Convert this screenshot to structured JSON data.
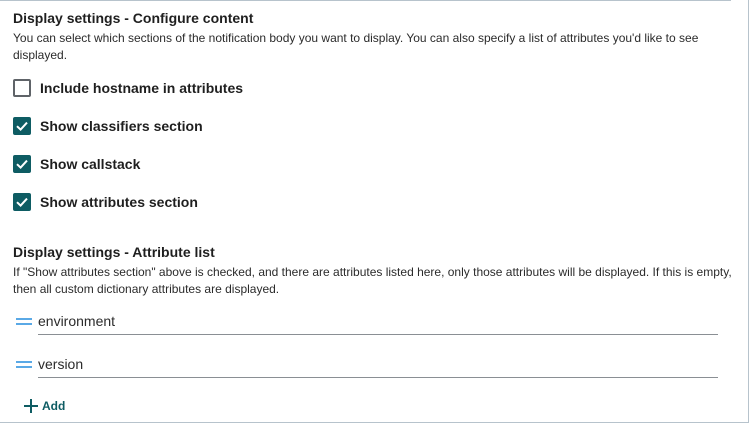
{
  "content_section": {
    "title": "Display settings - Configure content",
    "description": "You can select which sections of the notification body you want to display. You can also specify a list of attributes you'd like to see displayed."
  },
  "options": [
    {
      "label": "Include hostname in attributes",
      "checked": false
    },
    {
      "label": "Show classifiers section",
      "checked": true
    },
    {
      "label": "Show callstack",
      "checked": true
    },
    {
      "label": "Show attributes section",
      "checked": true
    }
  ],
  "attribute_section": {
    "title": "Display settings - Attribute list",
    "description": "If \"Show attributes section\" above is checked, and there are attributes listed here, only those attributes will be displayed. If this is empty, then all custom dictionary attributes are displayed.",
    "attributes": [
      "environment",
      "version"
    ],
    "add_label": "Add"
  },
  "colors": {
    "accent": "#0e5c63",
    "drag_handle": "#5aa9e6"
  }
}
